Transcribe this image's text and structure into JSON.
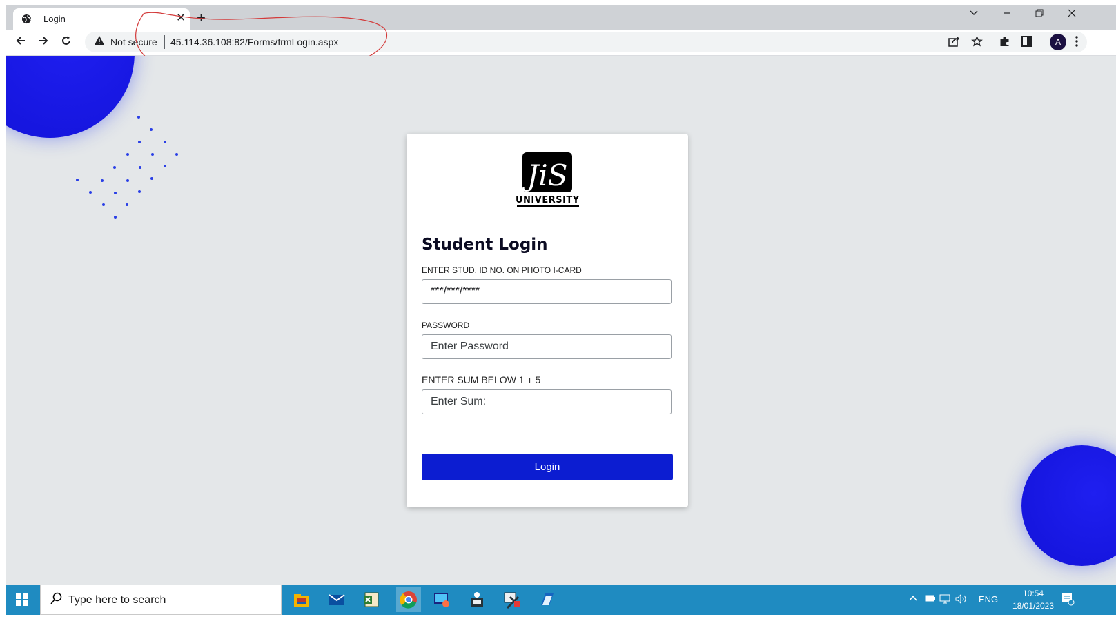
{
  "browser": {
    "tab_title": "Login",
    "tab_close": "✕",
    "new_tab": "+",
    "security_label": "Not secure",
    "url": "45.114.36.108:82/Forms/frmLogin.aspx",
    "avatar_initial": "A"
  },
  "logo": {
    "mark_text": "JiS",
    "word": "UNIVERSITY"
  },
  "form": {
    "heading": "Student Login",
    "id_label": "ENTER STUD. ID NO. ON PHOTO I-CARD",
    "id_value": "***/***/****",
    "password_label": "PASSWORD",
    "password_placeholder": "Enter Password",
    "sum_label": "ENTER SUM BELOW 1 + 5",
    "sum_placeholder": "Enter Sum:",
    "login_button": "Login"
  },
  "colors": {
    "accent_blue": "#0c1dd1",
    "page_bg": "#e4e7e9",
    "taskbar": "#1f8bc1",
    "annotation_red": "#d33a3a"
  },
  "taskbar": {
    "search_placeholder": "Type here to search",
    "language": "ENG",
    "time": "10:54",
    "date": "18/01/2023",
    "apps": [
      "file-explorer-icon",
      "mail-icon",
      "excel-icon",
      "chrome-icon",
      "remote-desktop-icon",
      "network-app-icon",
      "tools-app-icon",
      "notepad-app-icon"
    ],
    "tray_icons": [
      "chevron-up-icon",
      "battery-icon",
      "network-icon",
      "volume-icon"
    ]
  }
}
